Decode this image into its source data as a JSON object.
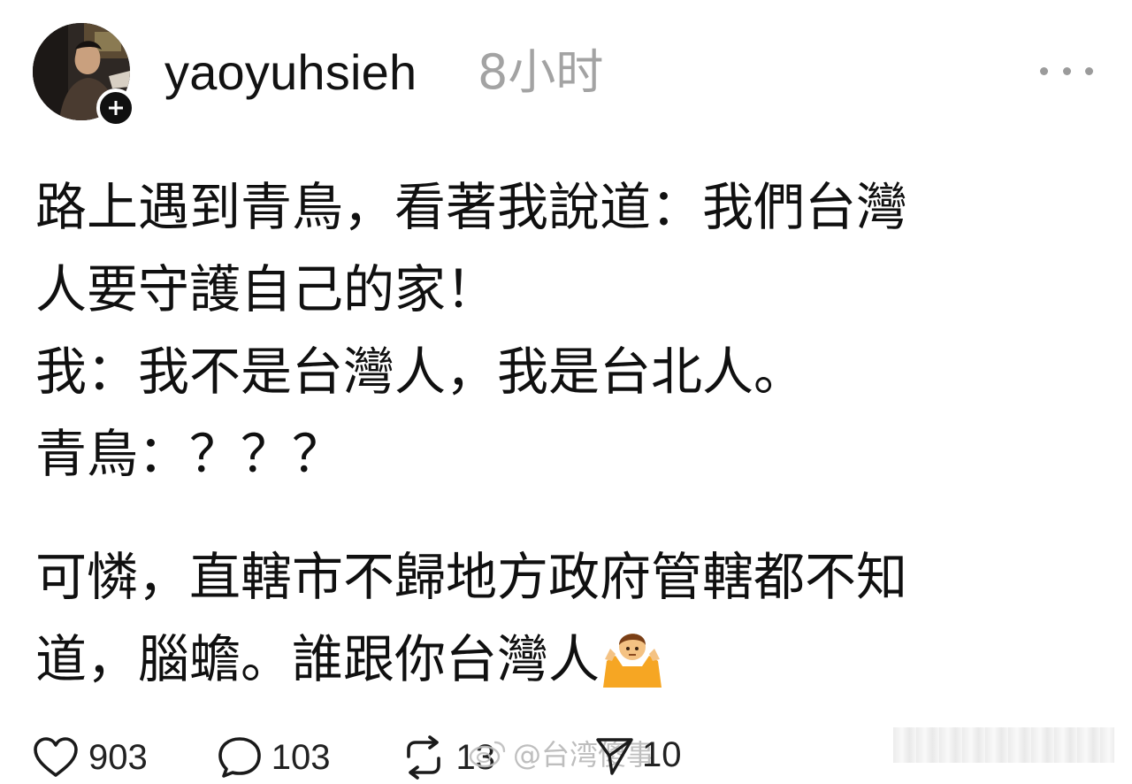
{
  "header": {
    "username": "yaoyuhsieh",
    "timestamp": "8小时"
  },
  "icons": {
    "avatar": "avatar-photo",
    "follow": "plus-icon",
    "more": "more-horizontal-icon",
    "like": "heart-icon",
    "reply": "speech-bubble-icon",
    "repost": "repost-icon",
    "share": "send-icon",
    "emoji": "person-shrugging-emoji"
  },
  "post": {
    "paragraph_1": "路上遇到青鳥，看著我說道：我們台灣\n人要守護自己的家！\n我：我不是台灣人，我是台北人。\n青鳥：？？？",
    "paragraph_2": "可憐，直轄市不歸地方政府管轄都不知\n道，腦蟾。誰跟你台灣人"
  },
  "actions": {
    "likes": "903",
    "replies": "103",
    "reposts": "13",
    "shares": "10"
  },
  "watermark": {
    "text": "@台湾傻事"
  },
  "colors": {
    "text": "#101010",
    "muted": "#a3a3a3",
    "background": "#ffffff"
  }
}
